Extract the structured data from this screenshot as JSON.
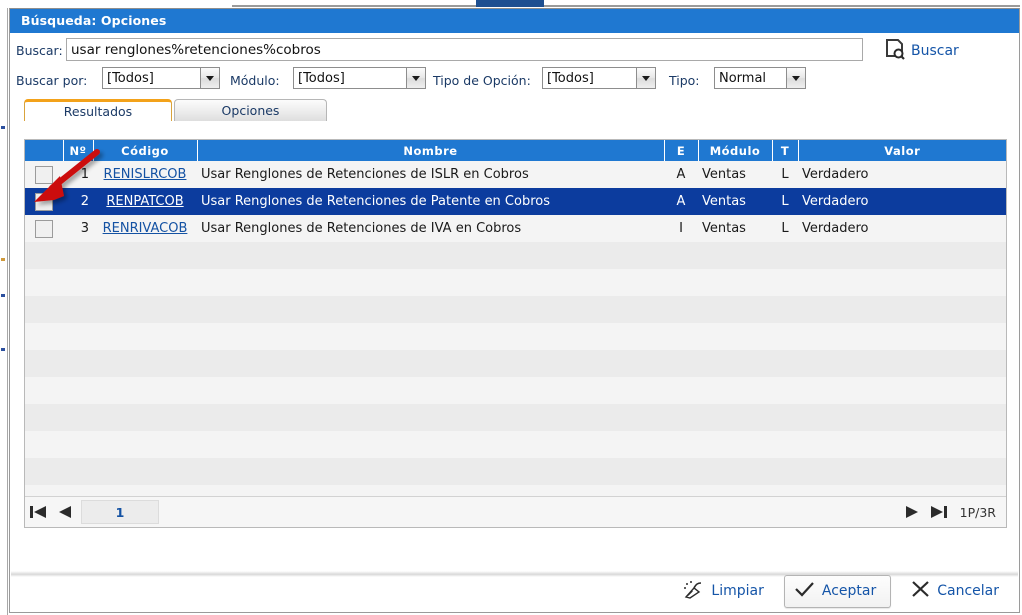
{
  "window": {
    "title": "Búsqueda: Opciones"
  },
  "search": {
    "label": "Buscar:",
    "value": "usar renglones%retenciones%cobros",
    "placeholder": "",
    "button_label": "Buscar",
    "button_icon": "document-search-icon"
  },
  "filters": [
    {
      "label": "Buscar por:",
      "value": "[Todos]",
      "name": "buscar-por"
    },
    {
      "label": "Módulo:",
      "value": "[Todos]",
      "name": "modulo"
    },
    {
      "label": "Tipo de Opción:",
      "value": "[Todos]",
      "name": "tipo-de-opcion"
    },
    {
      "label": "Tipo:",
      "value": "Normal",
      "name": "tipo"
    }
  ],
  "tabs": [
    {
      "label": "Resultados",
      "active": true
    },
    {
      "label": "Opciones",
      "active": false
    }
  ],
  "grid": {
    "columns": [
      "",
      "Nº",
      "Código",
      "Nombre",
      "E",
      "Módulo",
      "T",
      "Valor"
    ],
    "rows": [
      {
        "num": "1",
        "codigo": "RENISLRCOB",
        "nombre": "Usar Renglones de Retenciones de ISLR en Cobros",
        "e": "A",
        "modulo": "Ventas",
        "t": "L",
        "valor": "Verdadero",
        "checked": false,
        "selected": false
      },
      {
        "num": "2",
        "codigo": "RENPATCOB",
        "nombre": "Usar Renglones de Retenciones de Patente en Cobros",
        "e": "A",
        "modulo": "Ventas",
        "t": "L",
        "valor": "Verdadero",
        "checked": false,
        "selected": true
      },
      {
        "num": "3",
        "codigo": "RENRIVACOB",
        "nombre": "Usar Renglones de Retenciones de IVA en Cobros",
        "e": "I",
        "modulo": "Ventas",
        "t": "L",
        "valor": "Verdadero",
        "checked": false,
        "selected": false
      }
    ],
    "empty_row_count": 9
  },
  "pager": {
    "first_icon": "first-page-icon",
    "prev_icon": "previous-page-icon",
    "next_icon": "next-page-icon",
    "last_icon": "last-page-icon",
    "page_value": "1",
    "count_label": "1P/3R"
  },
  "footer": {
    "limpiar_label": "Limpiar",
    "limpiar_icon": "broom-icon",
    "aceptar_label": "Aceptar",
    "aceptar_icon": "checkmark-icon",
    "cancelar_label": "Cancelar",
    "cancelar_icon": "close-x-icon"
  },
  "annotation": {
    "arrow_color": "#cc1111",
    "target": "row-2-checkbox"
  },
  "colors": {
    "title_blue": "#1f78d1",
    "header_blue": "#1f78d1",
    "selected_row_blue": "#0c3c9e",
    "tab_accent_orange": "#f3a21a",
    "link_blue": "#1452a3",
    "label_blue": "#1b3a66"
  }
}
